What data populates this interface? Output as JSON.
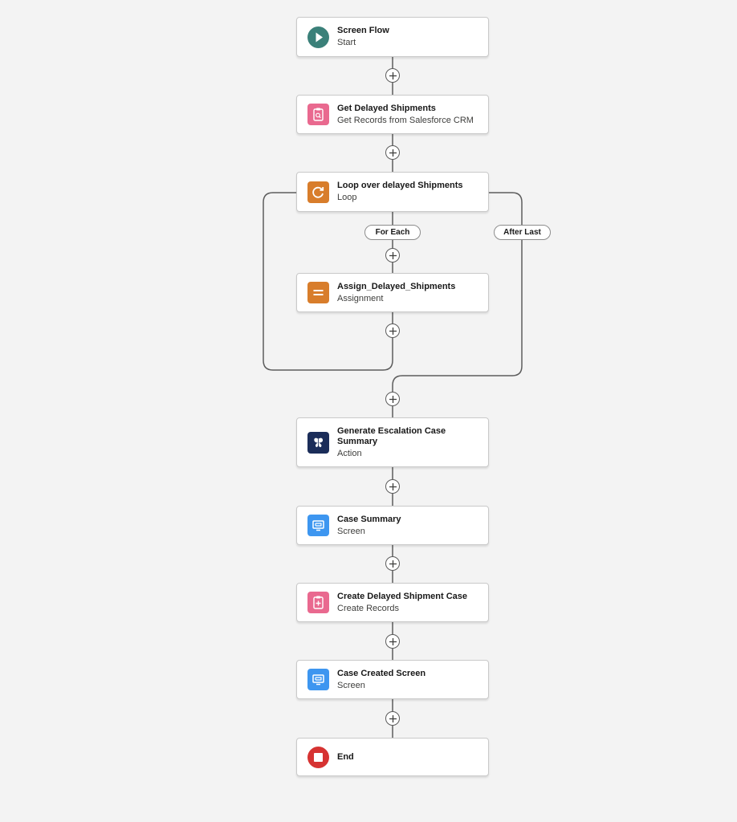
{
  "colors": {
    "start": "#3a8079",
    "record": "#e9698f",
    "logic": "#d87d2b",
    "action": "#1b2d59",
    "screen": "#3d96f0",
    "end": "#d63332"
  },
  "nodes": [
    {
      "key": "start",
      "title": "Screen Flow",
      "subtitle": "Start",
      "icon": "play-icon"
    },
    {
      "key": "get-delayed-shipments",
      "title": "Get Delayed Shipments",
      "subtitle": "Get Records from Salesforce CRM",
      "icon": "get-records-icon"
    },
    {
      "key": "loop",
      "title": "Loop over delayed Shipments",
      "subtitle": "Loop",
      "icon": "loop-icon"
    },
    {
      "key": "assign",
      "title": "Assign_Delayed_Shipments",
      "subtitle": "Assignment",
      "icon": "assignment-icon"
    },
    {
      "key": "generate-summary",
      "title": "Generate Escalation Case Summary",
      "subtitle": "Action",
      "icon": "einstein-action-icon"
    },
    {
      "key": "case-summary",
      "title": "Case Summary",
      "subtitle": "Screen",
      "icon": "screen-icon"
    },
    {
      "key": "create-case",
      "title": "Create Delayed Shipment Case",
      "subtitle": "Create Records",
      "icon": "create-records-icon"
    },
    {
      "key": "case-created",
      "title": "Case Created Screen",
      "subtitle": "Screen",
      "icon": "screen-icon"
    },
    {
      "key": "end",
      "title": "End",
      "subtitle": "",
      "icon": "stop-icon"
    }
  ],
  "loop_labels": {
    "for_each": "For Each",
    "after_last": "After Last"
  }
}
